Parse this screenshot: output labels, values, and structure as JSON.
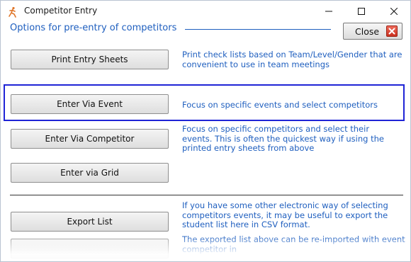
{
  "window": {
    "title": "Competitor Entry"
  },
  "title_controls": [
    "minimize-icon",
    "maximize-icon",
    "close-icon"
  ],
  "header": {
    "label": "Options for pre-entry of competitors",
    "close_label": "Close"
  },
  "options": [
    {
      "label": "Print Entry Sheets",
      "desc": "Print check lists based on Team/Level/Gender that are convenient to use in team meetings"
    },
    {
      "label": "Enter Via Event",
      "desc": "Focus on specific events and select competitors"
    },
    {
      "label": "Enter Via Competitor",
      "desc": "Focus on specific competitors and select their events.   This is often the quickest way if using the printed entry sheets from above"
    },
    {
      "label": "Enter via Grid",
      "desc": ""
    },
    {
      "label": "Export List",
      "desc": "If you have some other electronic way of selecting competitors events, it may be useful to export the student list here in CSV format."
    },
    {
      "label": "",
      "desc": "The exported list above can be re-imported with event competitor in"
    }
  ],
  "colors": {
    "accent": "#1f5fbf",
    "highlight": "#1f24d6",
    "close_icon": "#d9402e"
  }
}
